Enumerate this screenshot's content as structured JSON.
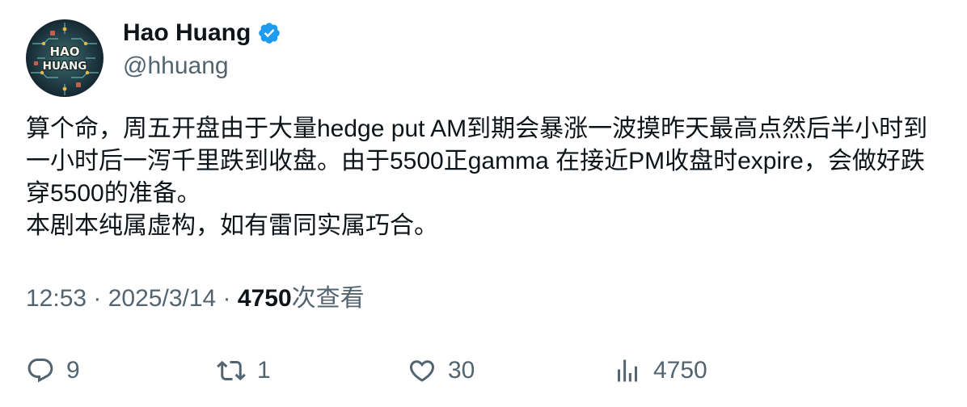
{
  "author": {
    "display_name": "Hao Huang",
    "handle": "@hhuang",
    "verified": true,
    "avatar_text_line1": "HAO",
    "avatar_text_line2": "HUANG",
    "verified_color": "#1d9bf0"
  },
  "tweet": {
    "text": "算个命，周五开盘由于大量hedge put AM到期会暴涨一波摸昨天最高点然后半小时到一小时后一泻千里跌到收盘。由于5500正gamma 在接近PM收盘时expire，会做好跌穿5500的准备。\n本剧本纯属虚构，如有雷同实属巧合。",
    "time": "12:53",
    "separator": " · ",
    "date": "2025/3/14",
    "views_count": "4750",
    "views_label": "次查看"
  },
  "actions": {
    "reply": {
      "icon": "reply-icon",
      "count": "9"
    },
    "retweet": {
      "icon": "retweet-icon",
      "count": "1"
    },
    "like": {
      "icon": "heart-icon",
      "count": "30"
    },
    "views": {
      "icon": "analytics-icon",
      "count": "4750"
    }
  },
  "colors": {
    "text_primary": "#0f1419",
    "text_secondary": "#536471"
  }
}
